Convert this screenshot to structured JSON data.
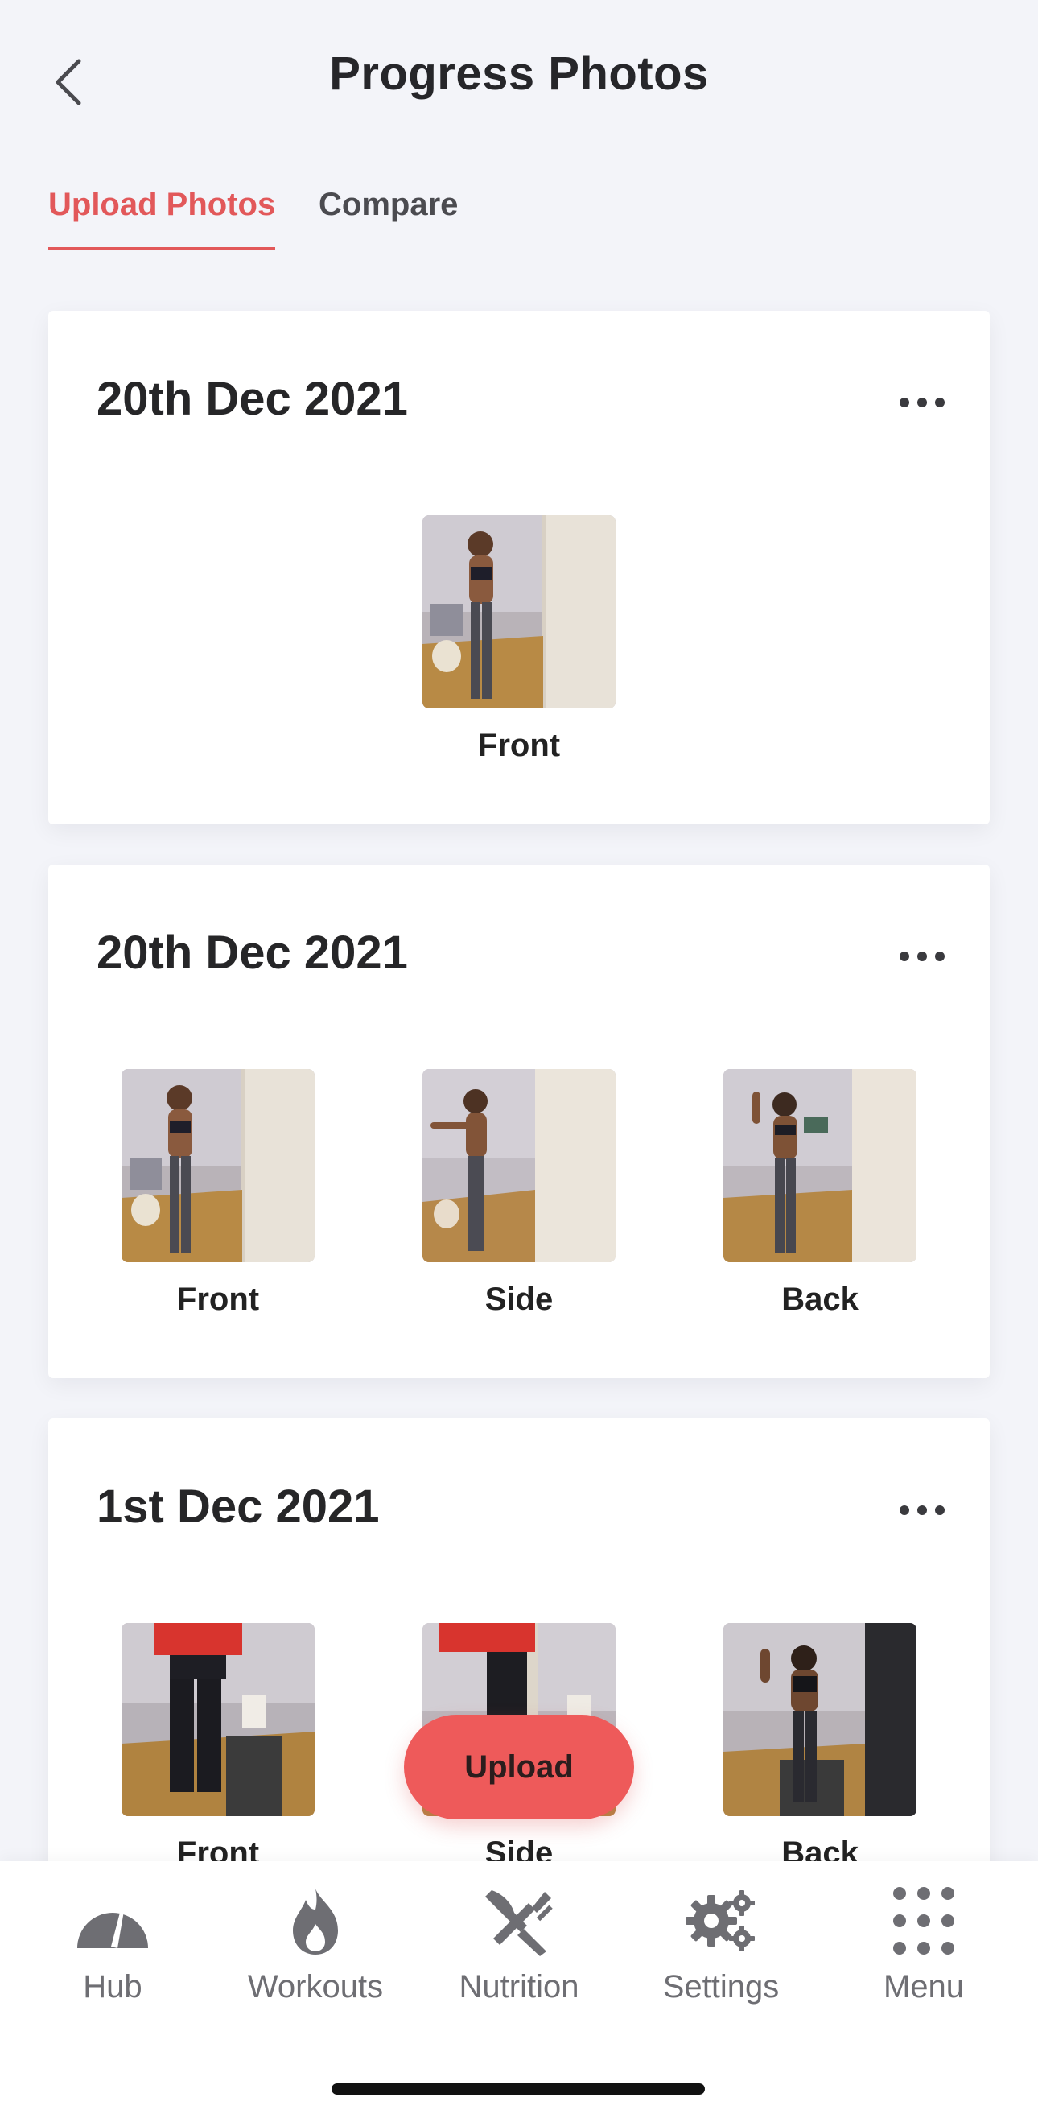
{
  "header": {
    "title": "Progress Photos"
  },
  "tabs": [
    {
      "label": "Upload Photos",
      "active": true
    },
    {
      "label": "Compare",
      "active": false
    }
  ],
  "entries": [
    {
      "date": "20th Dec 2021",
      "photos": [
        {
          "label": "Front"
        }
      ]
    },
    {
      "date": "20th Dec 2021",
      "photos": [
        {
          "label": "Front"
        },
        {
          "label": "Side"
        },
        {
          "label": "Back"
        }
      ]
    },
    {
      "date": "1st Dec 2021",
      "photos": [
        {
          "label": "Front"
        },
        {
          "label": "Side"
        },
        {
          "label": "Back"
        }
      ]
    }
  ],
  "upload_button": {
    "label": "Upload"
  },
  "nav": [
    {
      "label": "Hub",
      "icon": "gauge-icon"
    },
    {
      "label": "Workouts",
      "icon": "flame-icon"
    },
    {
      "label": "Nutrition",
      "icon": "fork-knife-icon"
    },
    {
      "label": "Settings",
      "icon": "gears-icon"
    },
    {
      "label": "Menu",
      "icon": "grid-dots-icon"
    }
  ],
  "colors": {
    "accent": "#e2585a",
    "upload_button": "#ee5a5a",
    "background": "#f3f4f9",
    "icon_gray": "#6e6e73"
  }
}
